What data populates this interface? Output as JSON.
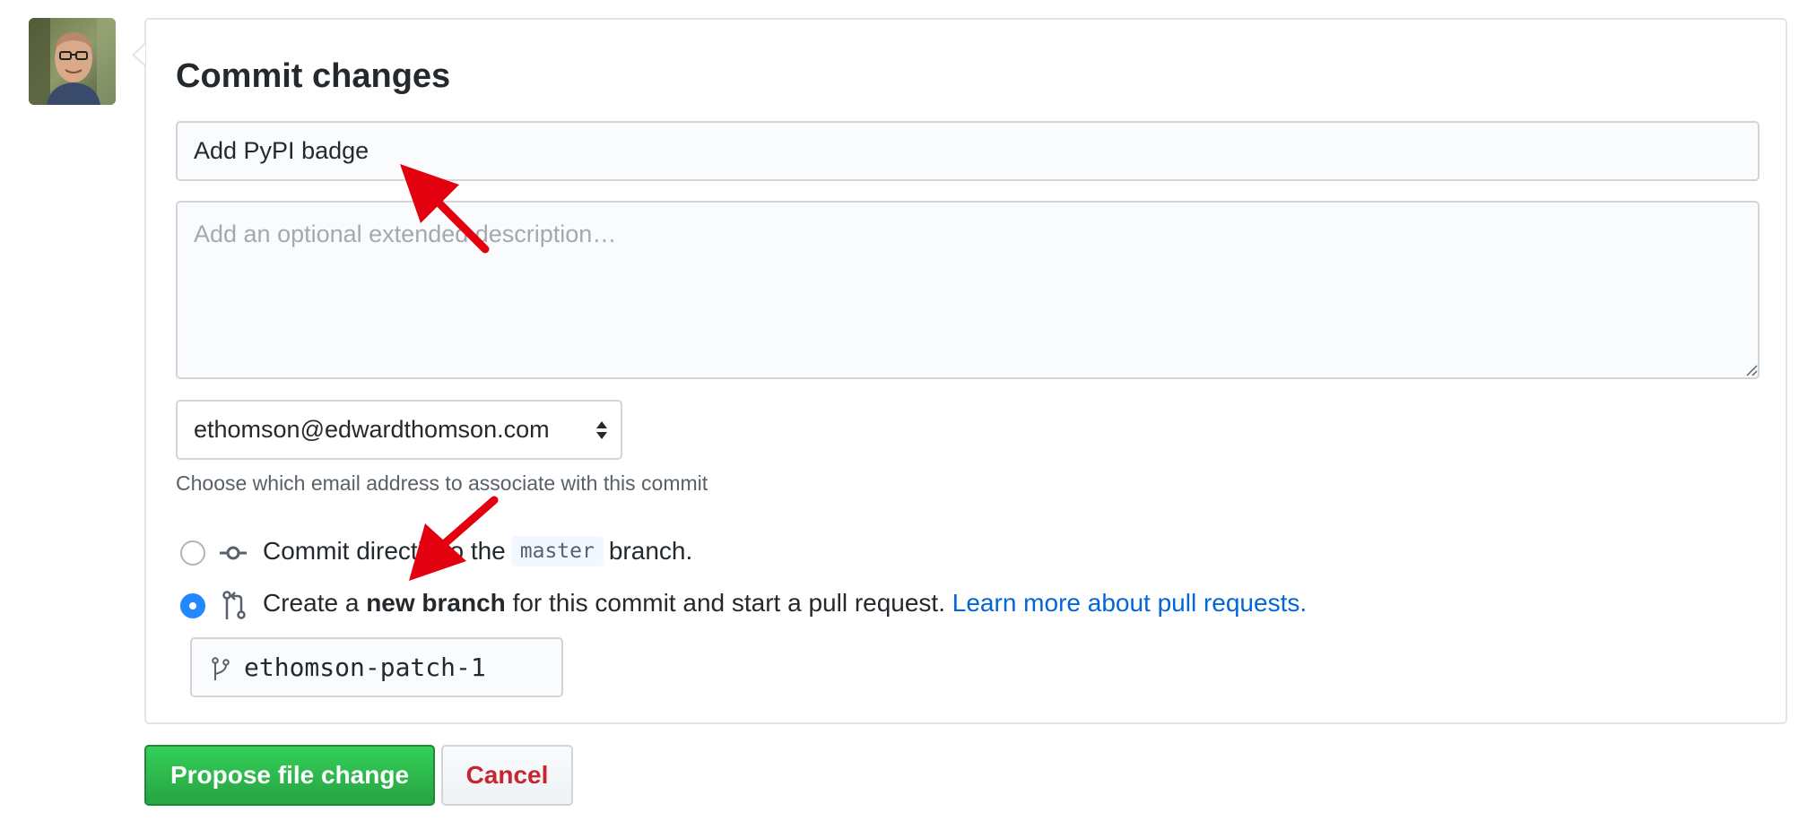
{
  "avatar": {
    "icon": "user-avatar-photo"
  },
  "commit_box": {
    "title": "Commit changes",
    "summary": {
      "value": "Add PyPI badge"
    },
    "description": {
      "placeholder": "Add an optional extended description…",
      "value": ""
    },
    "email_select": {
      "selected": "ethomson@edwardthomson.com"
    },
    "email_note": "Choose which email address to associate with this commit",
    "options": [
      {
        "selected": false,
        "icon": "git-commit-icon",
        "text_before": "Commit directly to the",
        "branch_code": "master",
        "text_after": "branch."
      },
      {
        "selected": true,
        "icon": "git-pull-request-icon",
        "text_before": "Create a",
        "bold_text": "new branch",
        "text_after": "for this commit and start a pull request.",
        "link_text": "Learn more about pull requests."
      }
    ],
    "branch_name": {
      "value": "ethomson-patch-1",
      "icon": "git-branch-icon"
    }
  },
  "actions": {
    "propose_label": "Propose file change",
    "cancel_label": "Cancel"
  },
  "colors": {
    "accent_blue": "#0366d6",
    "radio_blue": "#2188ff",
    "button_green": "#28a745",
    "cancel_red": "#cb2431",
    "annotation_arrow_red": "#e3000f"
  }
}
